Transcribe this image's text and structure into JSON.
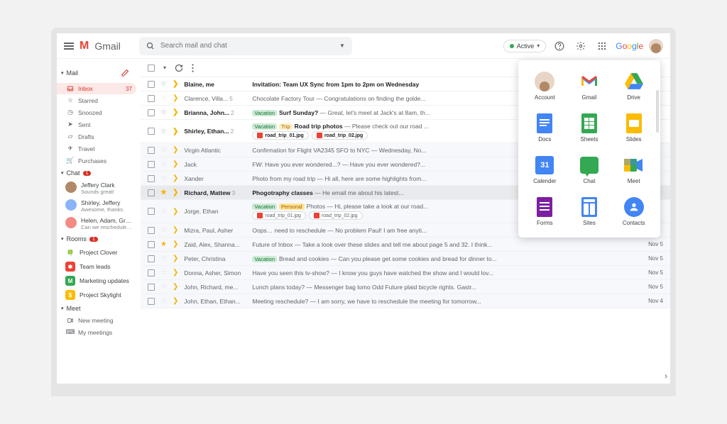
{
  "header": {
    "app_name": "Gmail",
    "search_placeholder": "Search mail and chat",
    "status_label": "Active",
    "google_word": "Google"
  },
  "sidebar": {
    "mail_label": "Mail",
    "mail_items": [
      {
        "icon": "inbox",
        "label": "Inbox",
        "count": "37",
        "active": true
      },
      {
        "icon": "star",
        "label": "Starred"
      },
      {
        "icon": "clock",
        "label": "Snoozed"
      },
      {
        "icon": "send",
        "label": "Sent"
      },
      {
        "icon": "draft",
        "label": "Drafts"
      },
      {
        "icon": "plane",
        "label": "Travel"
      },
      {
        "icon": "cart",
        "label": "Purchases"
      }
    ],
    "chat_label": "Chat",
    "chat_badge": "1",
    "chats": [
      {
        "name": "Jeffery Clark",
        "sub": "Sounds great!",
        "color": "#b08968"
      },
      {
        "name": "Shirley, Jeffery",
        "sub": "Awesome, thanks.",
        "color": "#8ab4f8"
      },
      {
        "name": "Helen, Adam, Gregory",
        "sub": "Can we reschedule the deliv...",
        "color": "#f28b82"
      }
    ],
    "rooms_label": "Rooms",
    "rooms_badge": "1",
    "rooms": [
      {
        "icon": "🍀",
        "bg": "#fff",
        "label": "Project Clover"
      },
      {
        "icon": "✱",
        "bg": "#ea4335",
        "label": "Team leads"
      },
      {
        "icon": "M",
        "bg": "#34a853",
        "label": "Marketing updates"
      },
      {
        "icon": "$",
        "bg": "#fbbc05",
        "label": "Project Skylight"
      }
    ],
    "meet_label": "Meet",
    "meet_items": [
      {
        "icon": "video",
        "label": "New meeting"
      },
      {
        "icon": "keyboard",
        "label": "My meetings"
      }
    ]
  },
  "emails": [
    {
      "unread": true,
      "star": false,
      "flag": true,
      "sender": "Blaine, me",
      "count": "",
      "subject": "Invitation: Team UX Sync from 1pm to 2pm on Wednesday",
      "snippet": "",
      "date": ""
    },
    {
      "unread": false,
      "star": false,
      "flag": true,
      "sender": "Clarence, Villa...",
      "count": "5",
      "tags": [],
      "subject": "Chocolate Factory Tour",
      "snippet": " — Congratulations on finding the golde...",
      "date": ""
    },
    {
      "unread": true,
      "star": false,
      "flag": true,
      "sender": "Brianna, John...",
      "count": "2",
      "tags": [
        "Vacation"
      ],
      "subject": "Surf Sunday?",
      "snippet": " — Great, let's meet at Jack's at 8am, th...",
      "date": ""
    },
    {
      "unread": true,
      "star": false,
      "flag": true,
      "sender": "Shirley, Ethan...",
      "count": "2",
      "tags": [
        "Vacation",
        "Trip"
      ],
      "subject": "Road trip photos",
      "snippet": " — Please check out our road ...",
      "date": "",
      "attachments": [
        "road_trip_01.jpg",
        "road_trip_02.jpg"
      ]
    },
    {
      "unread": false,
      "read": true,
      "star": false,
      "flag": true,
      "sender": "Virgin Atlantic",
      "subject": "Confirmation for Flight VA2345 SFO to NYC",
      "snippet": " — Wednesday, No...",
      "date": ""
    },
    {
      "unread": false,
      "read": true,
      "star": false,
      "flag": true,
      "sender": "Jack",
      "subject": "FW: Have you ever wondered...?",
      "snippet": " — Have you ever wondered?...",
      "date": ""
    },
    {
      "unread": false,
      "read": true,
      "star": false,
      "flag": true,
      "sender": "Xander",
      "subject": "Photo from my road trip",
      "snippet": " — Hi all, here are some highlights from...",
      "date": ""
    },
    {
      "unread": true,
      "selected": true,
      "star": true,
      "flag": true,
      "sender": "Richard, Mattew",
      "count": "3",
      "subject": "Phogotraphy classes",
      "snippet": " — He email me about his latest...",
      "date": ""
    },
    {
      "unread": false,
      "read": true,
      "star": false,
      "flag": true,
      "sender": "Jorge, Ethan",
      "tags": [
        "Vacation",
        "Personal"
      ],
      "subject": "Photos",
      "snippet": " — Hi, please take a look at our road...",
      "date": "",
      "attachments": [
        "road_trip_01.jpg",
        "road_trip_02.jpg"
      ]
    },
    {
      "unread": false,
      "read": true,
      "star": false,
      "flag": true,
      "sender": "Mizra, Paul, Asher",
      "subject": "Oops… need to reschedule",
      "snippet": " — No problem Paul! I am free anyti...",
      "date": ""
    },
    {
      "unread": false,
      "read": true,
      "star": true,
      "flag": true,
      "sender": "Zaid, Alex, Shanna...",
      "subject": "Future of Inbox",
      "snippet": " — Take a look over these slides and tell me about page 5 and 32. I think...",
      "date": "Nov 5"
    },
    {
      "unread": false,
      "read": true,
      "star": false,
      "flag": true,
      "sender": "Peter, Christina",
      "tags": [
        "Vacation"
      ],
      "subject": "Bread and cookies",
      "snippet": " — Can you please get some cookies and bread for dinner to...",
      "date": "Nov 5"
    },
    {
      "unread": false,
      "read": true,
      "star": false,
      "flag": true,
      "sender": "Donna, Asher, Simon",
      "subject": "Have you seen this tv-show?",
      "snippet": " — I know you guys have watched the show and I would lov...",
      "date": "Nov 5"
    },
    {
      "unread": false,
      "read": true,
      "star": false,
      "flag": true,
      "sender": "John, Richard, me...",
      "subject": "Lunch plans today?",
      "snippet": " — Messenger bag lomo Odd Future plaid bicycle rights. Gastr...",
      "date": "Nov 5"
    },
    {
      "unread": false,
      "read": true,
      "star": false,
      "flag": true,
      "sender": "John, Ethan, Ethan...",
      "subject": "Meeting reschedule?",
      "snippet": " — I am sorry, we have to reschedule the meeting for tomorrow...",
      "date": "Nov 4"
    }
  ],
  "apps_popup": [
    {
      "label": "Account",
      "icon": "avatar"
    },
    {
      "label": "Gmail",
      "icon": "gmail"
    },
    {
      "label": "Drive",
      "icon": "drive"
    },
    {
      "label": "Docs",
      "icon": "docs"
    },
    {
      "label": "Sheets",
      "icon": "sheets"
    },
    {
      "label": "Slides",
      "icon": "slides"
    },
    {
      "label": "Calender",
      "icon": "calendar"
    },
    {
      "label": "Chat",
      "icon": "chat"
    },
    {
      "label": "Meet",
      "icon": "meet"
    },
    {
      "label": "Forms",
      "icon": "forms"
    },
    {
      "label": "Sites",
      "icon": "sites"
    },
    {
      "label": "Contacts",
      "icon": "contacts"
    }
  ]
}
